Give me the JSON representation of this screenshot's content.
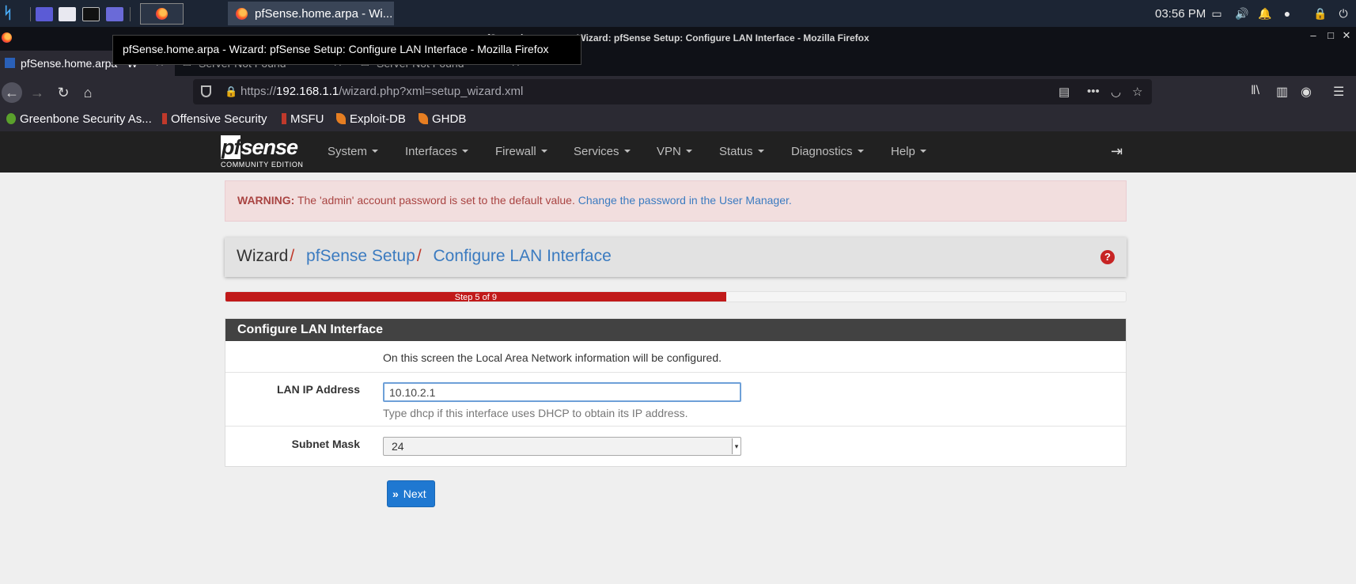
{
  "taskbar": {
    "clock": "03:56 PM",
    "task_title": "pfSense.home.arpa - Wi..."
  },
  "window": {
    "title": "pfSense.home.arpa - Wizard: pfSense Setup: Configure LAN Interface - Mozilla Firefox",
    "tooltip": "pfSense.home.arpa - Wizard: pfSense Setup: Configure LAN Interface - Mozilla Firefox"
  },
  "tabs": [
    {
      "label": "pfSense.home.arpa - W"
    },
    {
      "label": "Server Not Found"
    },
    {
      "label": "Server Not Found"
    }
  ],
  "urlbar": {
    "prefix": "https://",
    "host": "192.168.1.1",
    "path": "/wizard.php?xml=setup_wizard.xml"
  },
  "bookmarks": [
    {
      "label": "Greenbone Security As..."
    },
    {
      "label": "Offensive Security"
    },
    {
      "label": "MSFU"
    },
    {
      "label": "Exploit-DB"
    },
    {
      "label": "GHDB"
    }
  ],
  "pfsense": {
    "logo_text": "pfsense",
    "logo_sub": "COMMUNITY EDITION",
    "menu": [
      "System",
      "Interfaces",
      "Firewall",
      "Services",
      "VPN",
      "Status",
      "Diagnostics",
      "Help"
    ]
  },
  "alert": {
    "strong": "WARNING:",
    "text": " The 'admin' account password is set to the default value. ",
    "link": "Change the password in the User Manager."
  },
  "breadcrumb": {
    "root": "Wizard",
    "sep": "/",
    "level1": "pfSense Setup",
    "level2": "Configure LAN Interface"
  },
  "progress": {
    "label": "Step 5 of 9",
    "fraction": 0.556
  },
  "panel": {
    "title": "Configure LAN Interface",
    "intro": "On this screen the Local Area Network information will be configured.",
    "lan_ip_label": "LAN IP Address",
    "lan_ip_value": "10.10.2.1",
    "lan_ip_hint": "Type dhcp if this interface uses DHCP to obtain its IP address.",
    "subnet_label": "Subnet Mask",
    "subnet_value": "24"
  },
  "buttons": {
    "next": "Next"
  },
  "colors": {
    "pf_nav_bg": "#212121",
    "progress_red": "#c11a1a",
    "link_blue": "#3b7bc0",
    "panel_head": "#424242",
    "next_blue": "#1f78d1"
  }
}
